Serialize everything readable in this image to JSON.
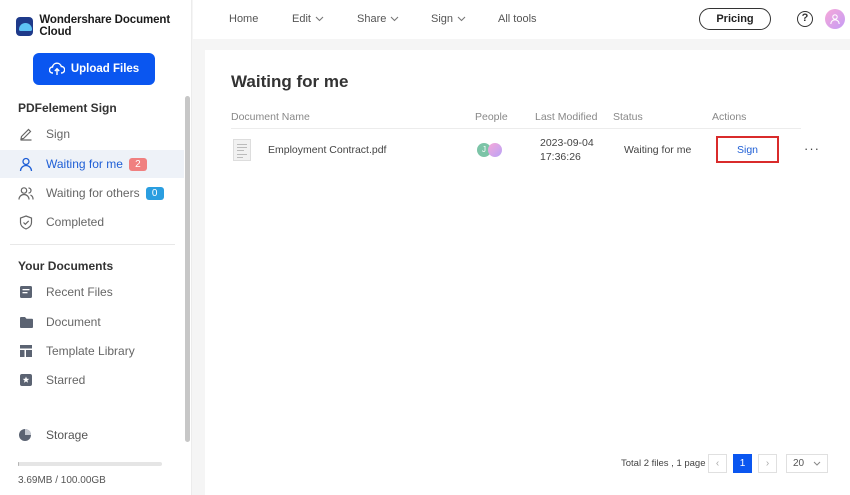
{
  "brand": {
    "name": "Wondershare Document Cloud"
  },
  "sidebar": {
    "upload_label": "Upload Files",
    "section_sign": "PDFelement Sign",
    "sign_items": [
      {
        "label": "Sign",
        "icon": "pen-icon"
      },
      {
        "label": "Waiting for me",
        "icon": "user-icon",
        "badge": "2"
      },
      {
        "label": "Waiting for others",
        "icon": "users-icon",
        "badge": "0"
      },
      {
        "label": "Completed",
        "icon": "shield-check-icon"
      }
    ],
    "section_docs": "Your Documents",
    "doc_items": [
      {
        "label": "Recent Files",
        "icon": "recent-files-icon"
      },
      {
        "label": "Document",
        "icon": "folder-icon"
      },
      {
        "label": "Template Library",
        "icon": "template-icon"
      },
      {
        "label": "Starred",
        "icon": "star-icon"
      }
    ],
    "storage_label": "Storage",
    "storage_usage": "3.69MB / 100.00GB",
    "storage_fraction": 3.69e-05
  },
  "topbar": {
    "nav": [
      {
        "label": "Home",
        "dropdown": false
      },
      {
        "label": "Edit",
        "dropdown": true
      },
      {
        "label": "Share",
        "dropdown": true
      },
      {
        "label": "Sign",
        "dropdown": true
      },
      {
        "label": "All tools",
        "dropdown": false
      }
    ],
    "pricing_label": "Pricing",
    "help_symbol": "?"
  },
  "main": {
    "title": "Waiting for me",
    "columns": [
      "Document Name",
      "People",
      "Last Modified",
      "Status",
      "Actions"
    ],
    "rows": [
      {
        "name": "Employment Contract.pdf",
        "person_initial": "J",
        "date": "2023-09-04",
        "time": "17:36:26",
        "status": "Waiting for me",
        "action_label": "Sign",
        "more_symbol": "···"
      }
    ],
    "pagination": {
      "summary": "Total 2 files , 1 page",
      "prev_symbol": "‹",
      "current_page": "1",
      "next_symbol": "›",
      "page_size": "20"
    }
  },
  "colors": {
    "accent": "#0a56f0",
    "highlight_border": "#d92b2b",
    "badge_red": "#f08080",
    "badge_blue": "#2a9ee0"
  }
}
